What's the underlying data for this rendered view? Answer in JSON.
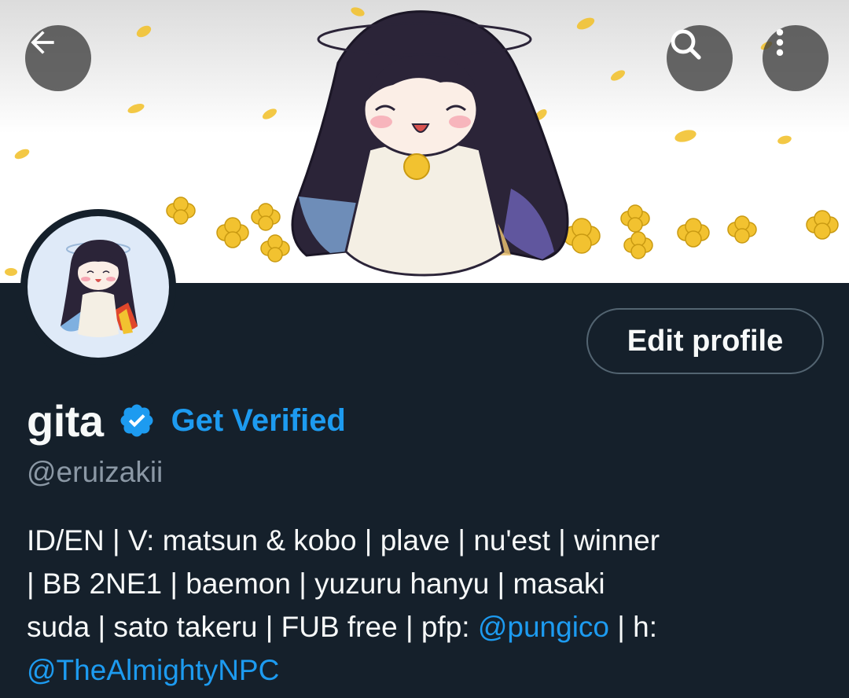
{
  "colors": {
    "background": "#15202b",
    "accent": "#1d9bf0",
    "text_primary": "#f7f9f9",
    "text_secondary": "#8b98a5",
    "button_border": "#536471"
  },
  "top_bar": {
    "back_icon": "arrow-left-icon",
    "search_icon": "search-icon",
    "more_icon": "more-vertical-icon"
  },
  "profile": {
    "display_name": "gita",
    "verified_icon": "verified-badge-icon",
    "get_verified_label": "Get Verified",
    "handle": "@eruizakii",
    "edit_profile_label": "Edit profile",
    "bio": {
      "line1": "ID/EN | V: matsun & kobo | plave | nu'est | winner",
      "line2": "| BB 2NE1 | baemon | yuzuru hanyu | masaki",
      "line3_prefix": "suda | sato takeru | FUB free | pfp: ",
      "line3_mention": "@pungico",
      "line3_suffix": " | h:",
      "line4_mention": "@TheAlmightyNPC"
    }
  }
}
